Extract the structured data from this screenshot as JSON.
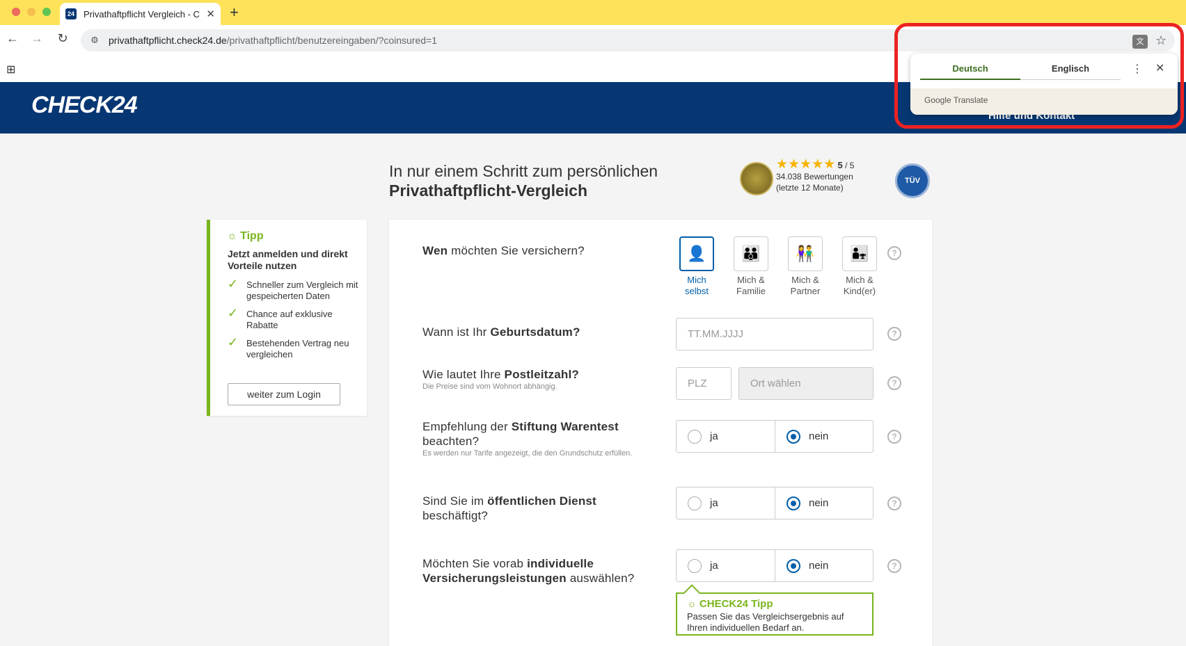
{
  "browser": {
    "tab_title": "Privathaftpflicht Vergleich - C",
    "tab_favicon_text": "24",
    "url_host": "privathaftpflicht.check24.de",
    "url_path": "/privathaftpflicht/benutzereingaben/?coinsured=1"
  },
  "translate": {
    "tab_source": "Deutsch",
    "tab_target": "Englisch",
    "footer": "Google Translate",
    "accent_color": "#3c6e1e",
    "outline_color": "#ec2222"
  },
  "header": {
    "logo": "CHECK24",
    "help_link": "Hilfe und Kontakt",
    "bg_color": "#063773"
  },
  "title": {
    "line1": "In nur einem Schritt zum persönlichen",
    "line2": "Privathaftpflicht-Vergleich"
  },
  "rating": {
    "stars": "★★★★★",
    "score": "5",
    "max": "/ 5",
    "reviews": "34.038 Bewertungen",
    "period": "(letzte 12 Monate)",
    "tuv_label": "TÜV"
  },
  "tipp": {
    "heading": "Tipp",
    "subheading": "Jetzt anmelden und direkt Vorteile nutzen",
    "items": [
      "Schneller zum Vergleich mit gespeicherten Daten",
      "Chance auf exklusive Rabatte",
      "Bestehenden Vertrag neu vergleichen"
    ],
    "login_button": "weiter zum Login",
    "accent_color": "#7ab51d"
  },
  "form": {
    "who": {
      "q_bold": "Wen",
      "q_rest": " möchten Sie versichern?",
      "options": [
        {
          "line1": "Mich",
          "line2": "selbst",
          "selected": true
        },
        {
          "line1": "Mich &",
          "line2": "Familie",
          "selected": false
        },
        {
          "line1": "Mich &",
          "line2": "Partner",
          "selected": false
        },
        {
          "line1": "Mich &",
          "line2": "Kind(er)",
          "selected": false
        }
      ]
    },
    "birthdate": {
      "q_pre": "Wann ist Ihr ",
      "q_bold": "Geburtsdatum?",
      "placeholder": "TT.MM.JJJJ"
    },
    "postcode": {
      "q_pre": "Wie lautet Ihre ",
      "q_bold": "Postleitzahl?",
      "hint": "Die Preise sind vom Wohnort abhängig.",
      "plz_placeholder": "PLZ",
      "ort_placeholder": "Ort wählen"
    },
    "warentest": {
      "q_pre": "Empfehlung der ",
      "q_bold": "Stiftung Warentest",
      "q_post": "beachten?",
      "hint": "Es werden nur Tarife angezeigt, die den Grundschutz erfüllen.",
      "yes": "ja",
      "no": "nein",
      "selected": "nein"
    },
    "public_service": {
      "q_pre": "Sind Sie im ",
      "q_bold": "öffentlichen Dienst",
      "q_post": "beschäftigt?",
      "yes": "ja",
      "no": "nein",
      "selected": "nein"
    },
    "individual": {
      "q_pre": "Möchten Sie vorab ",
      "q_bold1": "individuelle",
      "q_bold2": "Versicherungsleistungen",
      "q_post": " auswählen?",
      "yes": "ja",
      "no": "nein",
      "selected": "nein"
    },
    "c24_tipp": {
      "heading": "CHECK24 Tipp",
      "text": "Passen Sie das Vergleichsergebnis auf Ihren individuellen Bedarf an."
    },
    "help_glyph": "?",
    "accent_color": "#005ea8"
  }
}
